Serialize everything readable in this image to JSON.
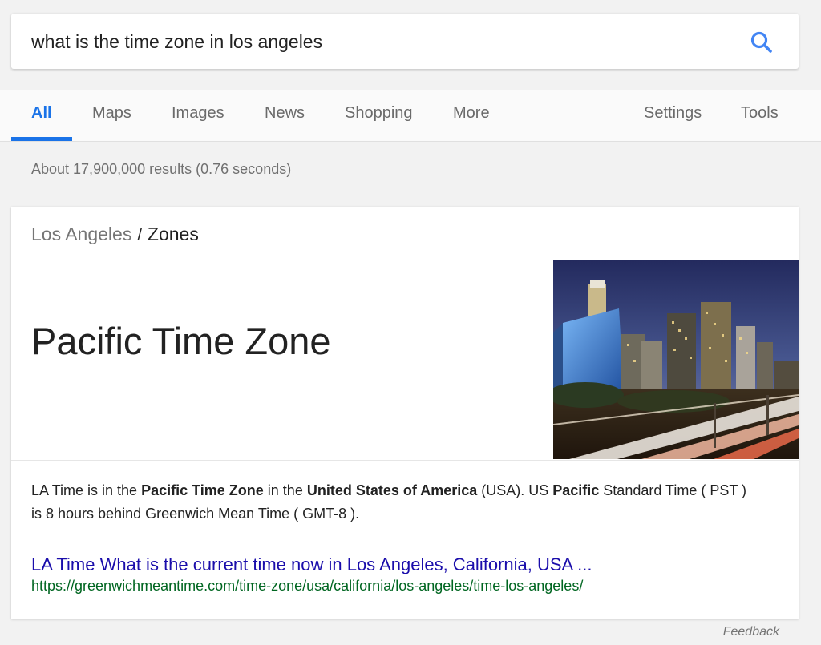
{
  "search": {
    "query": "what is the time zone in los angeles",
    "icon": "search-icon"
  },
  "tabs": {
    "items": [
      {
        "label": "All",
        "active": true
      },
      {
        "label": "Maps"
      },
      {
        "label": "Images"
      },
      {
        "label": "News"
      },
      {
        "label": "Shopping"
      },
      {
        "label": "More"
      }
    ],
    "settings": "Settings",
    "tools": "Tools"
  },
  "results_stats": "About 17,900,000 results (0.76 seconds)",
  "answer_card": {
    "breadcrumb": {
      "parent": "Los Angeles",
      "separator": "/",
      "current": "Zones"
    },
    "title": "Pacific Time Zone",
    "image_subject": "Los Angeles skyline at night with highway light trails",
    "description": {
      "parts": [
        {
          "text": "LA Time is in the ",
          "bold": false
        },
        {
          "text": "Pacific Time Zone",
          "bold": true
        },
        {
          "text": " in the ",
          "bold": false
        },
        {
          "text": "United States of America",
          "bold": true
        },
        {
          "text": " (USA). US ",
          "bold": false
        },
        {
          "text": "Pacific",
          "bold": true
        },
        {
          "text": " Standard Time ( PST ) is 8 hours behind Greenwich Mean Time ( GMT-8 ).",
          "bold": false
        }
      ]
    },
    "link": {
      "title": "LA Time What is the current time now in Los Angeles, California, USA ...",
      "url": "https://greenwichmeantime.com/time-zone/usa/california/los-angeles/time-los-angeles/"
    }
  },
  "feedback": "Feedback",
  "colors": {
    "accent": "#1a73e8",
    "link": "#1a0dab",
    "url": "#006621",
    "background": "#f2f2f2"
  }
}
